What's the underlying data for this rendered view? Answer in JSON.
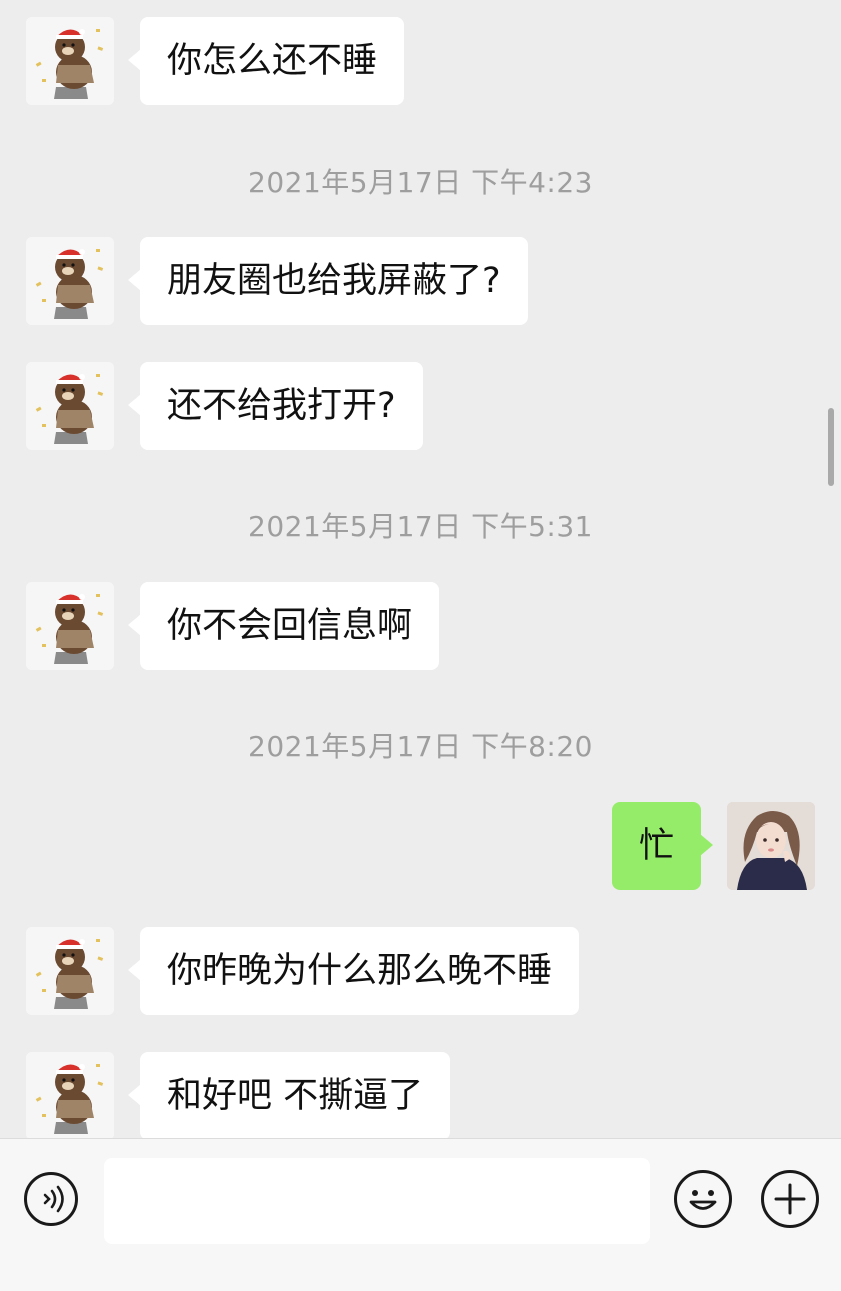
{
  "messages": [
    {
      "side": "left",
      "text": "你怎么还不睡"
    },
    {
      "side": "left",
      "text": "朋友圈也给我屏蔽了?"
    },
    {
      "side": "left",
      "text": "还不给我打开?"
    },
    {
      "side": "left",
      "text": "你不会回信息啊"
    },
    {
      "side": "right",
      "text": "忙"
    },
    {
      "side": "left",
      "text": "你昨晚为什么那么晚不睡"
    },
    {
      "side": "left",
      "text": "和好吧 不撕逼了"
    }
  ],
  "timestamps": [
    "2021年5月17日 下午4:23",
    "2021年5月17日 下午5:31",
    "2021年5月17日 下午8:20"
  ],
  "input": {
    "voice_icon": "voice-icon",
    "emoji_icon": "emoji-icon",
    "plus_icon": "plus-icon"
  },
  "colors": {
    "background": "#ededed",
    "incoming_bubble": "#ffffff",
    "outgoing_bubble": "#95ec69",
    "timestamp_text": "#9e9e9e"
  }
}
